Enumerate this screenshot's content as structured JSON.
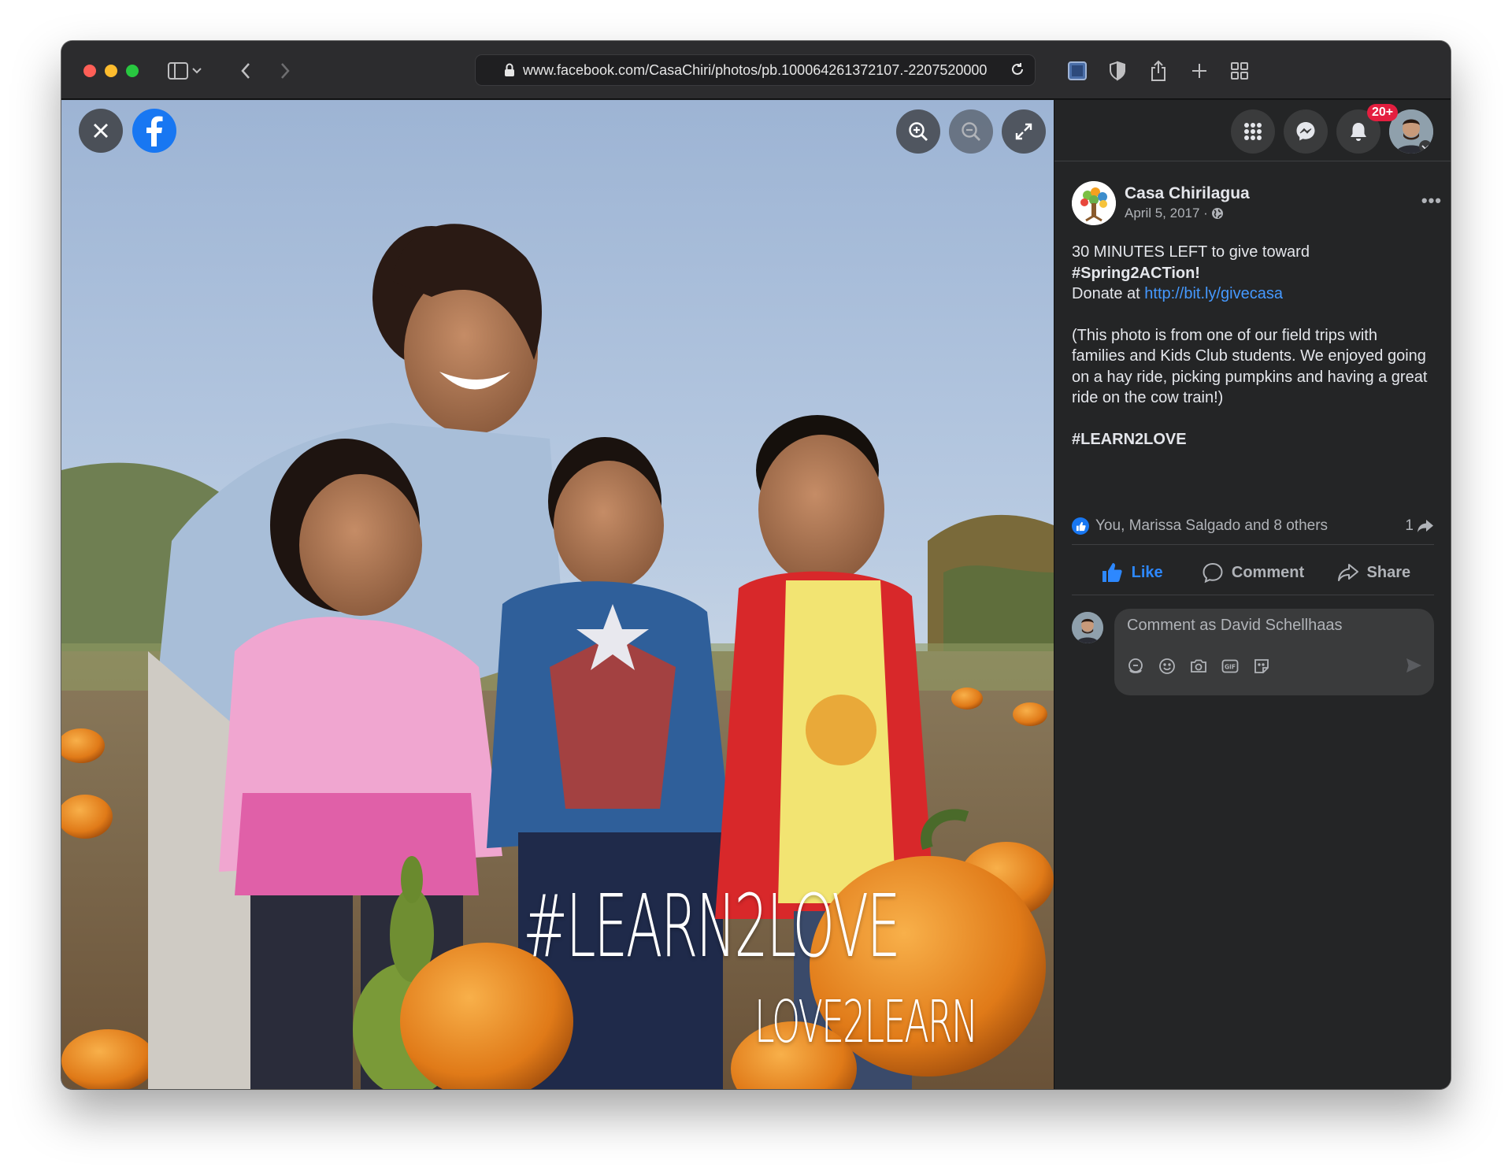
{
  "browser": {
    "url": "www.facebook.com/CasaChiri/photos/pb.100064261372107.-2207520000"
  },
  "viewer": {
    "watermark_main": "#LEARN2LOVE",
    "watermark_sub": "LOVE2LEARN"
  },
  "nav": {
    "notification_badge": "20+"
  },
  "post": {
    "page_name": "Casa Chirilagua",
    "date": "April 5, 2017 ·",
    "more": "•••",
    "line1": "30 MINUTES LEFT to give toward",
    "hashtag1": "#Spring2ACTion!",
    "donate_prefix": "Donate at ",
    "donate_link": "http://bit.ly/givecasa",
    "paragraph2": "(This photo is from one of our field trips with families and Kids Club students. We enjoyed going on a hay ride, picking pumpkins and having a great ride on the cow train!)",
    "hashtag2": "#LEARN2LOVE"
  },
  "reactions": {
    "summary": "You, Marissa Salgado and 8 others",
    "shares": "1"
  },
  "actions": {
    "like": "Like",
    "comment": "Comment",
    "share": "Share"
  },
  "comment": {
    "placeholder": "Comment as David Schellhaas"
  },
  "colors": {
    "facebook_blue": "#1877f2",
    "link_blue": "#4599ff",
    "badge_red": "#e41e3f",
    "panel_bg": "#242526"
  }
}
